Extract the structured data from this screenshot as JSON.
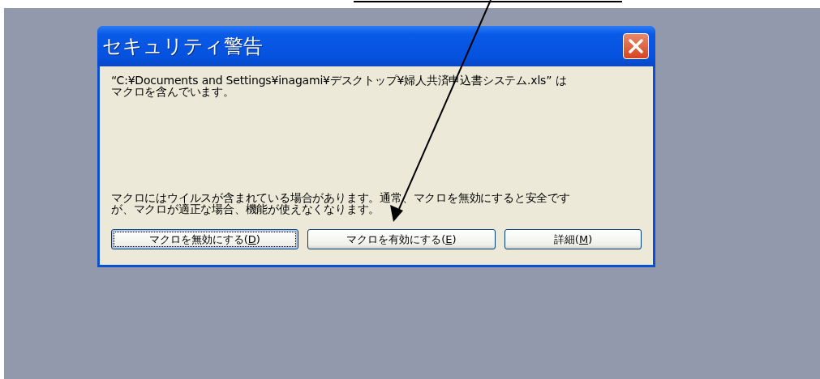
{
  "dialog": {
    "title": "セキュリティ警告",
    "message_lines": [
      "“C:¥Documents and Settings¥inagami¥デスクトップ¥婦人共済申込書システム.xls” は",
      "マクロを含んでいます。"
    ],
    "warning_lines": [
      "マクロにはウイルスが含まれている場合があります。通常、マクロを無効にすると安全です",
      "が、マクロが適正な場合、機能が使えなくなります。"
    ],
    "buttons": [
      {
        "before": "マクロを無効にする(",
        "key": "D",
        "after": ")",
        "focused": true
      },
      {
        "before": "マクロを有効にする(",
        "key": "E",
        "after": ")",
        "focused": false
      },
      {
        "before": "詳細(",
        "key": "M",
        "after": ")",
        "focused": false
      }
    ]
  }
}
